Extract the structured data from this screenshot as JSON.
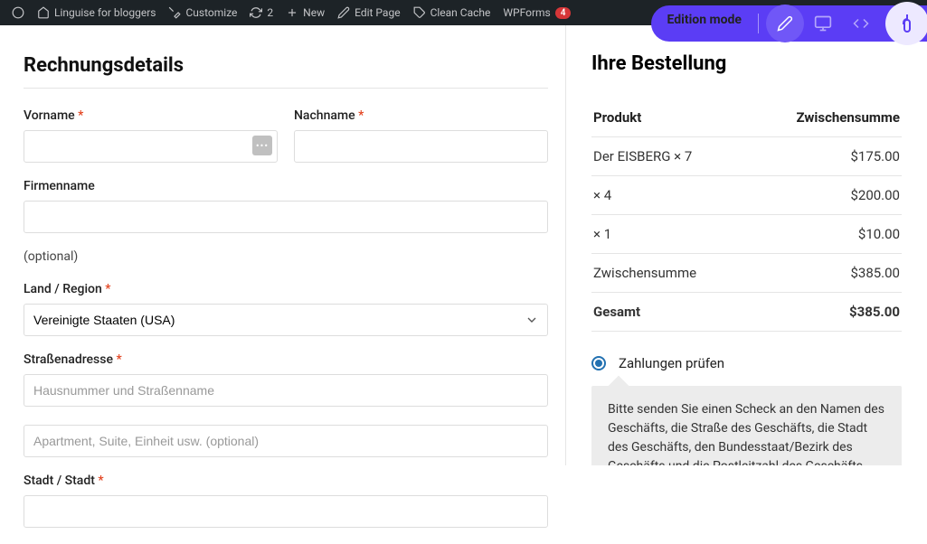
{
  "adminbar": {
    "site": "Linguise for bloggers",
    "customize": "Customize",
    "updates": "2",
    "new": "New",
    "edit": "Edit Page",
    "cache": "Clean Cache",
    "wpforms": "WPForms",
    "wpforms_badge": "4"
  },
  "editionbar": {
    "label": "Edition mode"
  },
  "billing": {
    "title": "Rechnungsdetails",
    "firstname": "Vorname",
    "lastname": "Nachname",
    "company": "Firmenname",
    "optional": "(optional)",
    "country": "Land / Region",
    "country_value": "Vereinigte Staaten (USA)",
    "street": "Straßenadresse",
    "street_ph1": "Hausnummer und Straßenname",
    "street_ph2": "Apartment, Suite, Einheit usw. (optional)",
    "city": "Stadt / Stadt"
  },
  "order": {
    "title": "Ihre Bestellung",
    "col_product": "Produkt",
    "col_subtotal": "Zwischensumme",
    "items": [
      {
        "name": "Der EISBERG × 7",
        "price": "$175.00"
      },
      {
        "name": " × 4",
        "price": "$200.00"
      },
      {
        "name": " × 1",
        "price": "$10.00"
      }
    ],
    "subtotal_label": "Zwischensumme",
    "subtotal": "$385.00",
    "total_label": "Gesamt",
    "total": "$385.00"
  },
  "payment": {
    "check_label": "Zahlungen prüfen",
    "check_desc": "Bitte senden Sie einen Scheck an den Namen des Geschäfts, die Straße des Geschäfts, die Stadt des Geschäfts, den Bundesstaat/Bezirk des Geschäfts und die Postleitzahl des Geschäfts."
  }
}
